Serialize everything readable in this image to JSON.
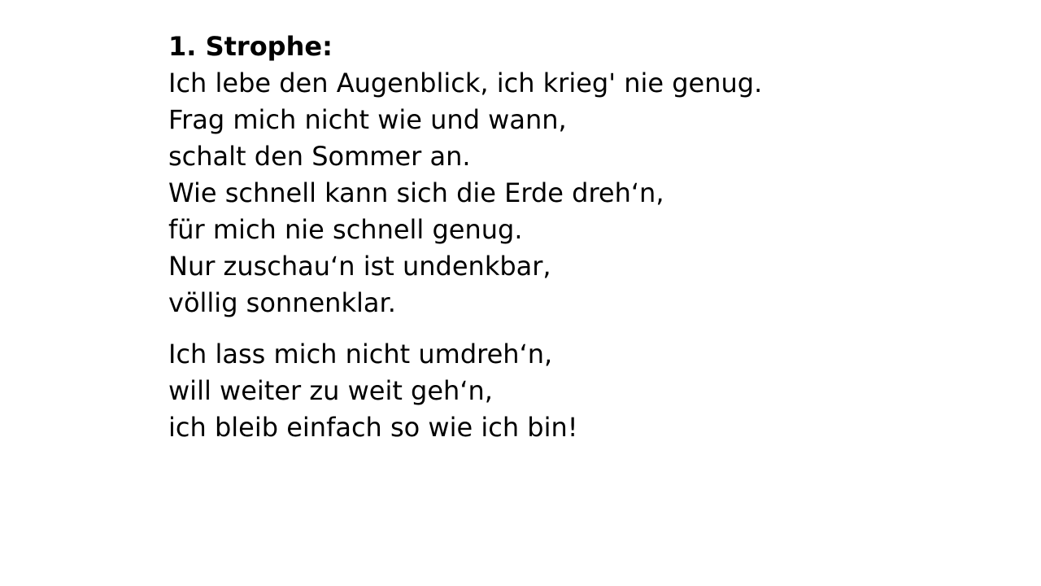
{
  "heading": "1. Strophe:",
  "verse": [
    "Ich lebe den Augenblick, ich krieg' nie genug.",
    "Frag mich nicht wie und wann,",
    "schalt den Sommer an.",
    "Wie schnell kann sich die Erde dreh‘n,",
    "für mich nie schnell genug.",
    "Nur zuschau‘n ist undenkbar,",
    "völlig sonnenklar."
  ],
  "chorus": [
    "Ich lass mich nicht umdreh‘n,",
    "will weiter zu weit geh‘n,",
    "ich bleib einfach so wie ich bin!"
  ]
}
